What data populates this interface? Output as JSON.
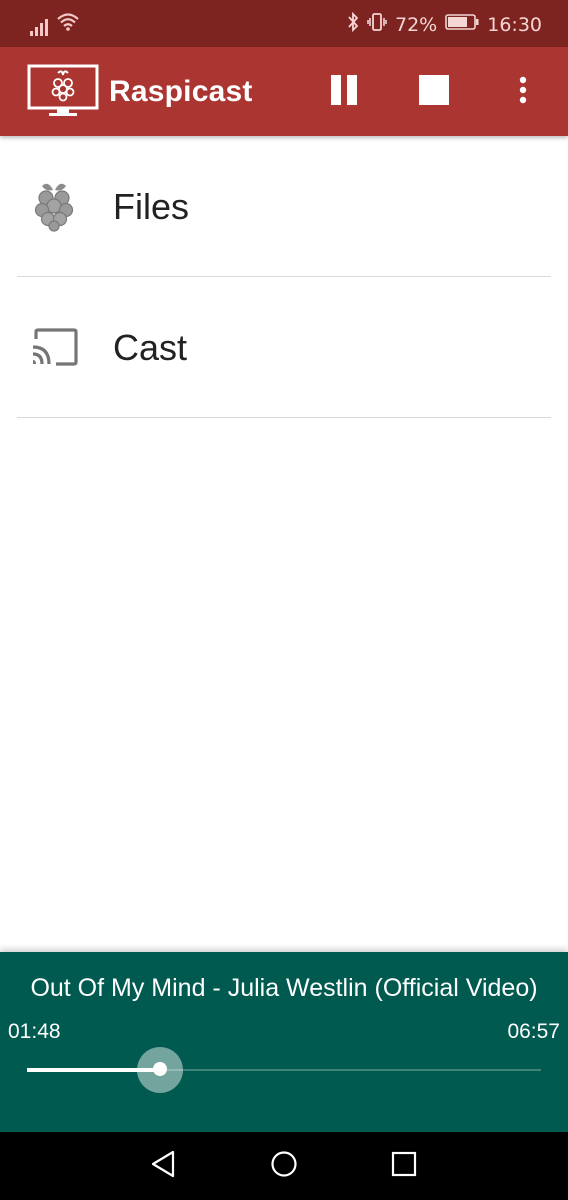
{
  "status_bar": {
    "battery": "72%",
    "time": "16:30",
    "icons": [
      "signal-icon",
      "wifi-icon",
      "bluetooth-icon",
      "vibrate-icon",
      "battery-icon"
    ]
  },
  "app_bar": {
    "title": "Raspicast",
    "icons": [
      "raspicast-logo-icon",
      "pause-icon",
      "stop-icon",
      "overflow-menu-icon"
    ]
  },
  "list": {
    "items": [
      {
        "label": "Files",
        "icon": "raspberry-icon"
      },
      {
        "label": "Cast",
        "icon": "cast-icon"
      }
    ]
  },
  "player": {
    "title": "Out Of My Mind - Julia Westlin (Official Video)",
    "elapsed": "01:48",
    "duration": "06:57",
    "progress_fraction": 0.259
  },
  "nav_bar": {
    "icons": [
      "back-icon",
      "home-icon",
      "recents-icon"
    ]
  },
  "colors": {
    "status_bar": "#7e2420",
    "app_bar": "#ab3530",
    "player": "#005a4f",
    "nav_bar": "#000000"
  }
}
